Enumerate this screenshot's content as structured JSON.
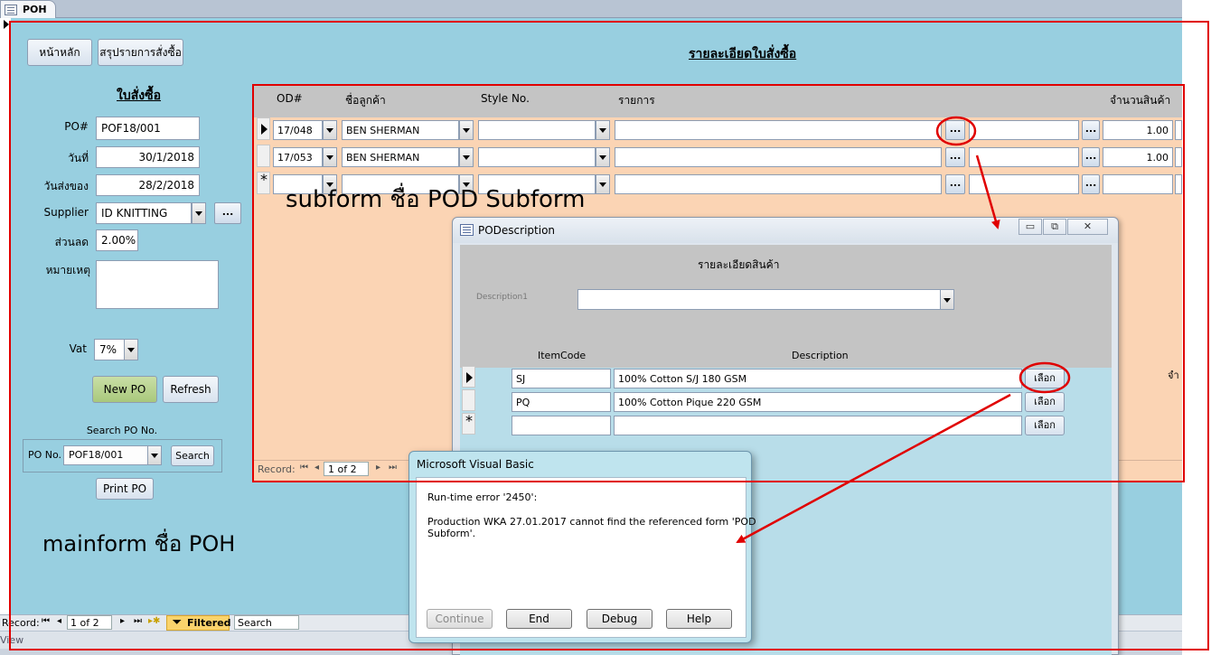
{
  "tab": {
    "title": "POH"
  },
  "main": {
    "home_button": "หน้าหลัก",
    "summary_button": "สรุปรายการสั่งซื้อ",
    "detail_heading": "รายละเอียดใบสั่งซื้อ",
    "po_heading": "ใบสั่งซื้อ",
    "fields": {
      "po_label": "PO#",
      "po_value": "POF18/001",
      "date_label": "วันที่",
      "date_value": "30/1/2018",
      "delivery_label": "วันส่งของ",
      "delivery_value": "28/2/2018",
      "supplier_label": "Supplier",
      "supplier_value": "ID KNITTING",
      "discount_label": "ส่วนลด",
      "discount_value": "2.00%",
      "remark_label": "หมายเหตุ",
      "remark_value": "",
      "vat_label": "Vat",
      "vat_value": "7%"
    },
    "new_po_button": "New PO",
    "refresh_button": "Refresh",
    "search_caption": "Search PO No.",
    "search_po_label": "PO No.",
    "search_po_value": "POF18/001",
    "search_button": "Search",
    "print_button": "Print PO",
    "ellipsis": "..."
  },
  "subform": {
    "headers": {
      "od": "OD#",
      "customer": "ชื่อลูกค้า",
      "style": "Style No.",
      "item": "รายการ",
      "qty": "จำนวนสินค้า"
    },
    "rows": [
      {
        "od": "17/048",
        "customer": "BEN SHERMAN",
        "style": "",
        "item": "",
        "item2": "",
        "qty": "1.00"
      },
      {
        "od": "17/053",
        "customer": "BEN SHERMAN",
        "style": "",
        "item": "",
        "item2": "",
        "qty": "1.00"
      }
    ],
    "nav": {
      "record_label": "Record:",
      "position": "1 of 2"
    }
  },
  "record_bar": {
    "label": "Record:",
    "position": "1 of 2",
    "filtered": "Filtered",
    "search": "Search"
  },
  "status_bar": {
    "view": "View"
  },
  "podescription": {
    "title": "PODescription",
    "heading": "รายละเอียดสินค้า",
    "description_label": "Description1",
    "description_value": "",
    "col_itemcode": "ItemCode",
    "col_description": "Description",
    "select_label": "เลือก",
    "rows": [
      {
        "code": "SJ",
        "description": "100% Cotton S/J 180 GSM"
      },
      {
        "code": "PQ",
        "description": "100% Cotton Pique 220 GSM"
      }
    ],
    "side_label": "จำ"
  },
  "vb_dialog": {
    "title": "Microsoft Visual Basic",
    "error_line": "Run-time error '2450':",
    "message_line1": "Production WKA 27.01.2017 cannot find the referenced form 'POD",
    "message_line2": "Subform'.",
    "buttons": {
      "continue": "Continue",
      "end": "End",
      "debug": "Debug",
      "help": "Help"
    }
  },
  "annotations": {
    "subform_note": "subform ชื่อ POD Subform",
    "mainform_note": "mainform ชื่อ POH",
    "color": "#e00000"
  }
}
